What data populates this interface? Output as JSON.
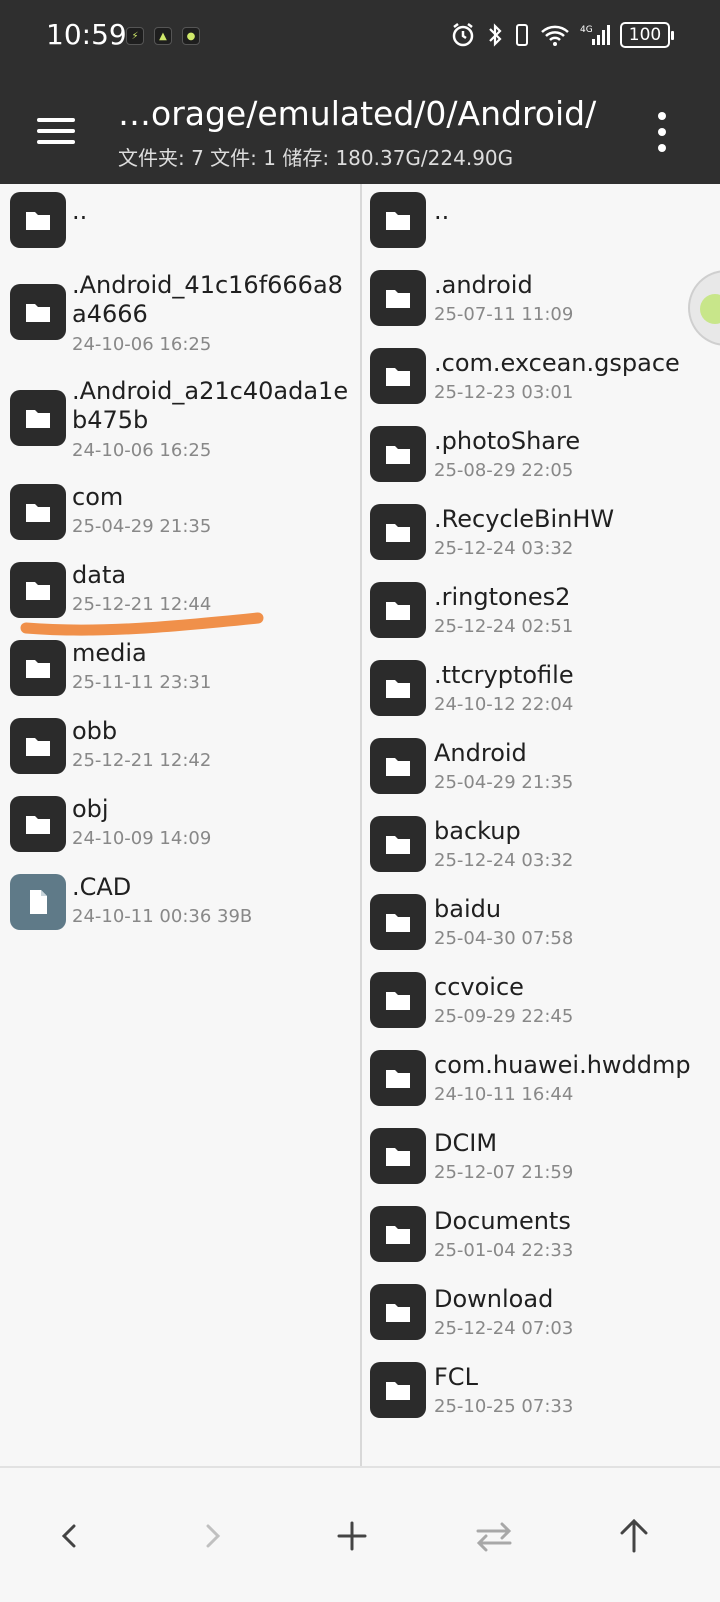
{
  "status_bar": {
    "time": "10:59",
    "battery": "100",
    "icons": [
      "alarm-icon",
      "bluetooth-icon",
      "vibrate-icon",
      "wifi-icon",
      "signal-icon",
      "battery-icon"
    ]
  },
  "toolbar": {
    "path": "…orage/emulated/0/Android/",
    "subtitle": "文件夹: 7  文件: 1  储存: 180.37G/224.90G"
  },
  "left_pane": {
    "items": [
      {
        "name": "..",
        "date": "",
        "type": "folder"
      },
      {
        "name": ".Android_41c16f666a8",
        "name2": "a4666",
        "date": "24-10-06 16:25",
        "type": "folder"
      },
      {
        "name": ".Android_a21c40ada1e",
        "name2": "b475b",
        "date": "24-10-06 16:25",
        "type": "folder"
      },
      {
        "name": "com",
        "date": "25-04-29 21:35",
        "type": "folder"
      },
      {
        "name": "data",
        "date": "25-12-21 12:44",
        "type": "folder"
      },
      {
        "name": "media",
        "date": "25-11-11 23:31",
        "type": "folder"
      },
      {
        "name": "obb",
        "date": "25-12-21 12:42",
        "type": "folder"
      },
      {
        "name": "obj",
        "date": "24-10-09 14:09",
        "type": "folder"
      },
      {
        "name": ".CAD",
        "date": "24-10-11 00:36  39B",
        "type": "file"
      }
    ]
  },
  "right_pane": {
    "items": [
      {
        "name": "..",
        "date": ""
      },
      {
        "name": ".android",
        "date": "25-07-11 11:09"
      },
      {
        "name": ".com.excean.gspace",
        "date": "25-12-23 03:01"
      },
      {
        "name": ".photoShare",
        "date": "25-08-29 22:05"
      },
      {
        "name": ".RecycleBinHW",
        "date": "25-12-24 03:32"
      },
      {
        "name": ".ringtones2",
        "date": "25-12-24 02:51"
      },
      {
        "name": ".ttcryptofile",
        "date": "24-10-12 22:04"
      },
      {
        "name": "Android",
        "date": "25-04-29 21:35"
      },
      {
        "name": "backup",
        "date": "25-12-24 03:32"
      },
      {
        "name": "baidu",
        "date": "25-04-30 07:58"
      },
      {
        "name": "ccvoice",
        "date": "25-09-29 22:45"
      },
      {
        "name": "com.huawei.hwddmp",
        "date": "24-10-11 16:44"
      },
      {
        "name": "DCIM",
        "date": "25-12-07 21:59"
      },
      {
        "name": "Documents",
        "date": "25-01-04 22:33"
      },
      {
        "name": "Download",
        "date": "25-12-24 07:03"
      },
      {
        "name": "FCL",
        "date": "25-10-25 07:33"
      }
    ]
  },
  "bottom_bar": {
    "buttons": [
      "back-icon",
      "forward-icon",
      "add-icon",
      "swap-icon",
      "up-icon"
    ]
  },
  "colors": {
    "toolbar_bg": "#2f2f2f",
    "highlight": "#f0904a",
    "file_icon": "#5f7a88"
  }
}
